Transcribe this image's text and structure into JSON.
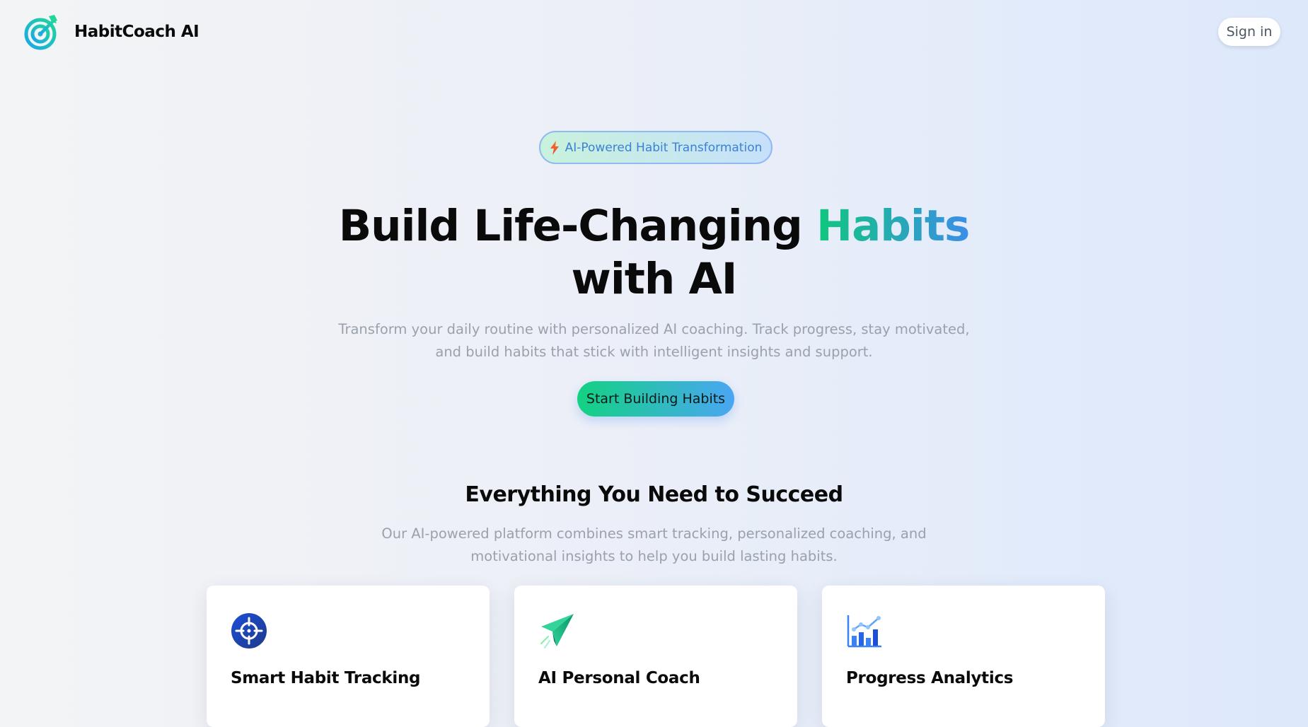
{
  "header": {
    "brand_name": "HabitCoach AI",
    "signin_label": "Sign in"
  },
  "hero": {
    "badge": "AI-Powered Habit Transformation",
    "title_part1": "Build Life-Changing ",
    "title_highlight": "Habits",
    "title_part2": "with AI",
    "subtitle_line1": "Transform your daily routine with personalized AI coaching. Track progress, stay motivated,",
    "subtitle_line2": "and build habits that stick with intelligent insights and support.",
    "cta_label": "Start Building Habits"
  },
  "features": {
    "title": "Everything You Need to Succeed",
    "subtitle_line1": "Our AI-powered platform combines smart tracking, personalized coaching, and",
    "subtitle_line2": "motivational insights to help you build lasting habits.",
    "cards": [
      {
        "title": "Smart Habit Tracking",
        "icon": "crosshair-target-icon"
      },
      {
        "title": "AI Personal Coach",
        "icon": "paper-plane-icon"
      },
      {
        "title": "Progress Analytics",
        "icon": "bar-chart-icon"
      }
    ]
  },
  "colors": {
    "accent_green": "#10c77d",
    "accent_blue": "#3b8ee8",
    "muted_text": "#9aa1ac"
  }
}
